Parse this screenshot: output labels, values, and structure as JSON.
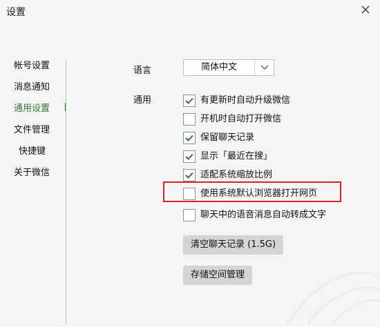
{
  "window": {
    "title": "设置"
  },
  "sidebar": {
    "items": [
      {
        "label": "帐号设置",
        "active": false
      },
      {
        "label": "消息通知",
        "active": false
      },
      {
        "label": "通用设置",
        "active": true
      },
      {
        "label": "文件管理",
        "active": false
      },
      {
        "label": "快捷键",
        "active": false
      },
      {
        "label": "关于微信",
        "active": false
      }
    ]
  },
  "main": {
    "language": {
      "label": "语言",
      "value": "简体中文"
    },
    "general": {
      "label": "通用",
      "options": [
        {
          "label": "有更新时自动升级微信",
          "checked": true
        },
        {
          "label": "开机时自动打开微信",
          "checked": false
        },
        {
          "label": "保留聊天记录",
          "checked": true
        },
        {
          "label": "显示「最近在搜」",
          "checked": true
        },
        {
          "label": "适配系统缩放比例",
          "checked": true
        },
        {
          "label": "使用系统默认浏览器打开网页",
          "checked": false
        },
        {
          "label": "聊天中的语音消息自动转成文字",
          "checked": false
        }
      ]
    },
    "buttons": {
      "clear_history": "清空聊天记录 (1.5G)",
      "storage": "存储空间管理"
    }
  },
  "colors": {
    "accent": "#2f7a2f",
    "highlight": "#e02020"
  }
}
